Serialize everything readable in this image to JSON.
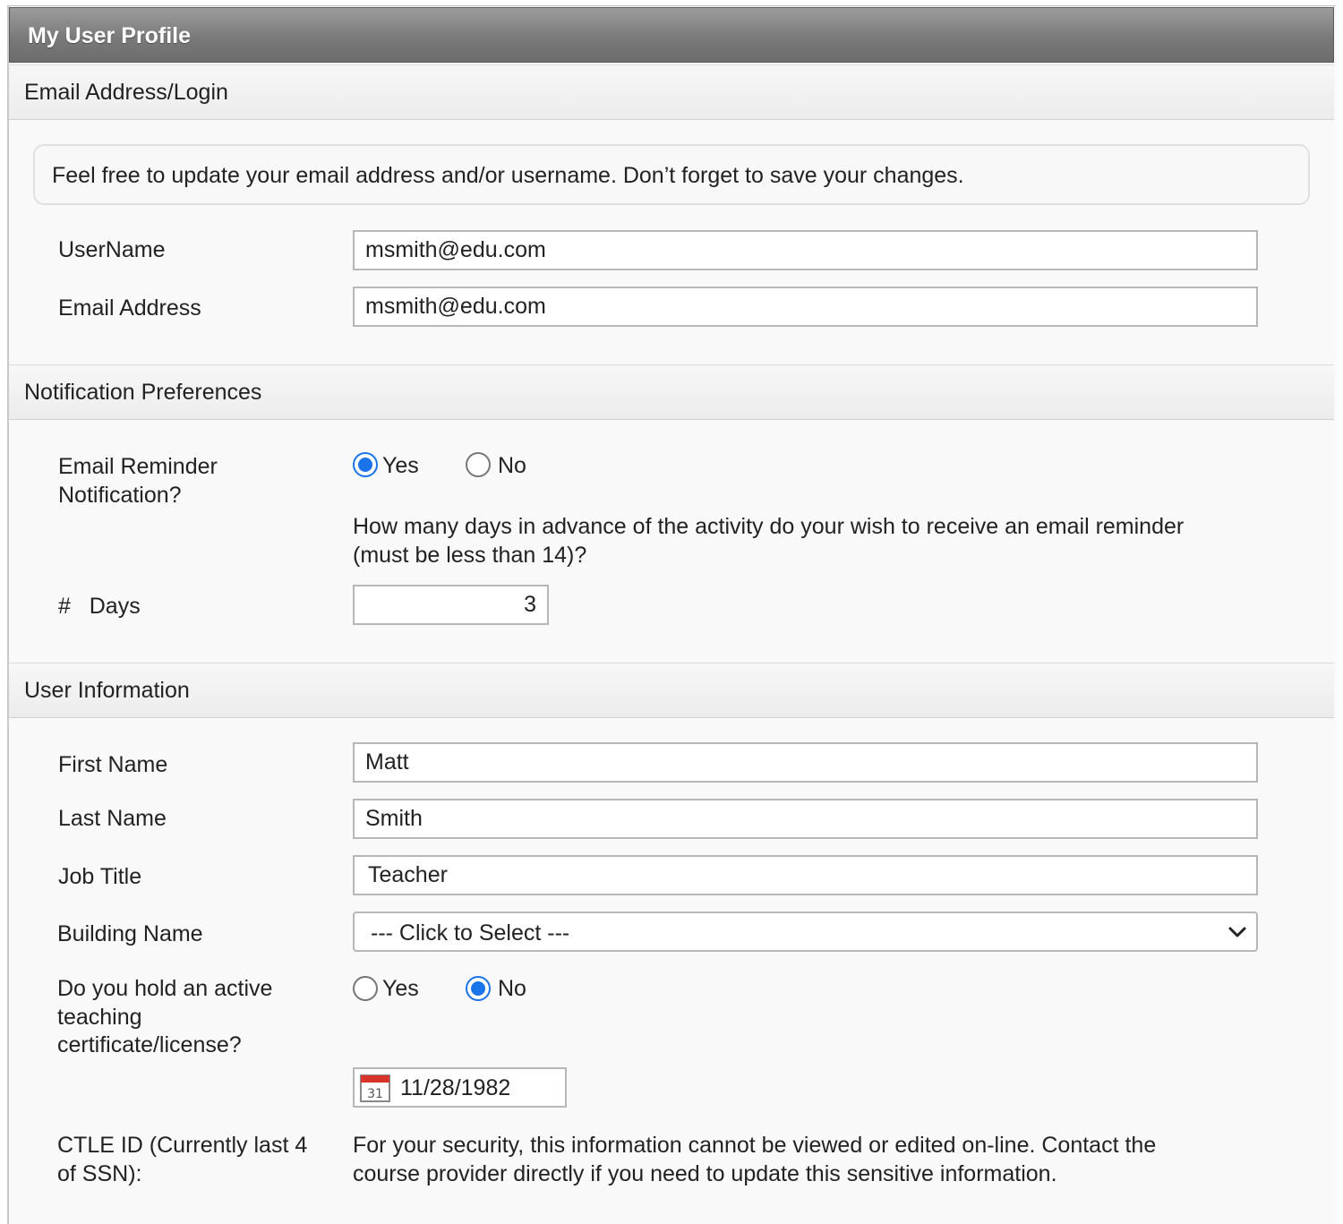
{
  "header": {
    "title": "My User Profile"
  },
  "sections": {
    "email_login": {
      "heading": "Email Address/Login",
      "info": "Feel free to update your email address and/or username. Don’t forget to save your changes.",
      "username_label": "UserName",
      "username_value": "msmith@edu.com",
      "email_label": "Email Address",
      "email_value": "msmith@edu.com"
    },
    "notifications": {
      "heading": "Notification Preferences",
      "reminder_label_line1": "Email Reminder",
      "reminder_label_line2": "Notification?",
      "yes_label": "Yes",
      "no_label": "No",
      "selected": "Yes",
      "days_question_line1": "How many days in advance of the activity do your wish to receive an email reminder",
      "days_question_line2": "(must be less than 14)?",
      "days_label": "#   Days",
      "days_value": "3"
    },
    "user_info": {
      "heading": "User Information",
      "first_name_label": "First Name",
      "first_name_value": "Matt",
      "last_name_label": "Last Name",
      "last_name_value": "Smith",
      "job_title_label": "Job Title",
      "job_title_value": "Teacher",
      "building_label": "Building Name",
      "building_value": "--- Click to Select ---",
      "certificate_label_line1": "Do you hold an active",
      "certificate_label_line2": "teaching",
      "certificate_label_line3": "certificate/license?",
      "yes_label": "Yes",
      "no_label": "No",
      "certificate_selected": "No",
      "date_value": "11/28/1982",
      "calendar_icon_text": "31",
      "ctle_label_line1": "CTLE ID (Currently last 4",
      "ctle_label_line2": "of SSN):",
      "ctle_info_line1": "For your security, this information cannot be viewed or edited on-line. Contact the",
      "ctle_info_line2": "course provider directly if you need to update this sensitive information."
    }
  },
  "colors": {
    "accent": "#1a73e8",
    "title_bar": "#7a7a7a",
    "section_header": "#ececec",
    "border": "#b7b7b7"
  },
  "icons": [
    "calendar-icon",
    "chevron-down-icon"
  ]
}
